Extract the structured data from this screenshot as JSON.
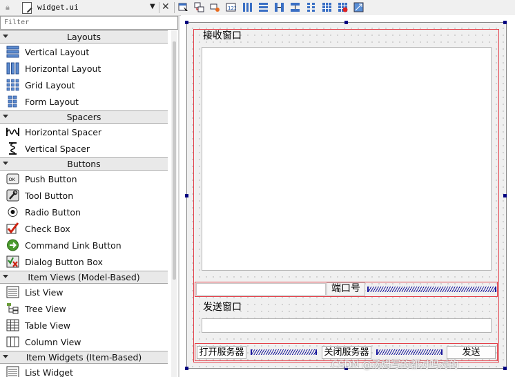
{
  "toolbar": {
    "file_name": "widget.ui",
    "tools": [
      "edit-widgets-icon",
      "edit-signals-slots-icon",
      "edit-buddies-icon",
      "edit-tab-order-icon",
      "lay-out-horizontally-icon",
      "lay-out-vertically-icon",
      "lay-out-horizontal-splitter-icon",
      "lay-out-vertical-splitter-icon",
      "lay-out-form-icon",
      "lay-out-grid-icon",
      "break-layout-icon",
      "adjust-size-icon"
    ]
  },
  "widget_box": {
    "filter_placeholder": "Filter",
    "categories": [
      {
        "label": "Layouts",
        "items": [
          {
            "label": "Vertical Layout",
            "icon": "vertical-layout-icon"
          },
          {
            "label": "Horizontal Layout",
            "icon": "horizontal-layout-icon"
          },
          {
            "label": "Grid Layout",
            "icon": "grid-layout-icon"
          },
          {
            "label": "Form Layout",
            "icon": "form-layout-icon"
          }
        ]
      },
      {
        "label": "Spacers",
        "items": [
          {
            "label": "Horizontal Spacer",
            "icon": "horizontal-spacer-icon"
          },
          {
            "label": "Vertical Spacer",
            "icon": "vertical-spacer-icon"
          }
        ]
      },
      {
        "label": "Buttons",
        "items": [
          {
            "label": "Push Button",
            "icon": "push-button-icon"
          },
          {
            "label": "Tool Button",
            "icon": "tool-button-icon"
          },
          {
            "label": "Radio Button",
            "icon": "radio-button-icon"
          },
          {
            "label": "Check Box",
            "icon": "check-box-icon"
          },
          {
            "label": "Command Link Button",
            "icon": "command-link-icon"
          },
          {
            "label": "Dialog Button Box",
            "icon": "dialog-button-box-icon"
          }
        ]
      },
      {
        "label": "Item Views (Model-Based)",
        "items": [
          {
            "label": "List View",
            "icon": "list-view-icon"
          },
          {
            "label": "Tree View",
            "icon": "tree-view-icon"
          },
          {
            "label": "Table View",
            "icon": "table-view-icon"
          },
          {
            "label": "Column View",
            "icon": "column-view-icon"
          }
        ]
      },
      {
        "label": "Item Widgets (Item-Based)",
        "items": [
          {
            "label": "List Widget",
            "icon": "list-widget-icon"
          }
        ]
      }
    ]
  },
  "form": {
    "receive_label": "接收窗口",
    "port_label": "端口号",
    "port_value": "",
    "send_label": "发送窗口",
    "send_value": "",
    "open_server_button": "打开服务器",
    "close_server_button": "关闭服务器",
    "send_button": "发送"
  },
  "watermark": "CSDN @汤姆写的都对吗对的",
  "colors": {
    "layout_border": "#e3414a",
    "spacer": "#1a1a9e",
    "handle": "#000080"
  }
}
